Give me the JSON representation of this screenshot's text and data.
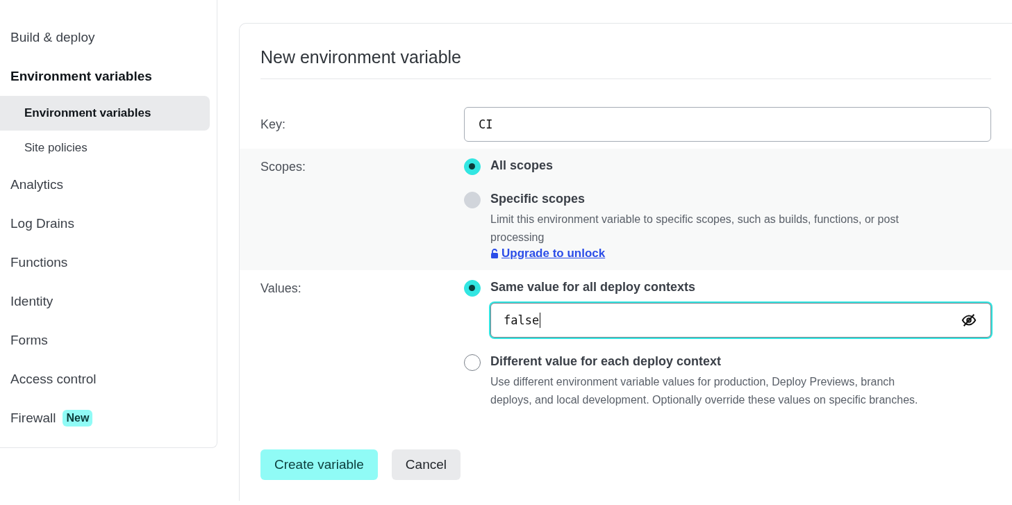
{
  "sidebar": {
    "items": [
      {
        "label": "Build & deploy",
        "selected": false
      },
      {
        "label": "Environment variables",
        "selected": false,
        "children": [
          {
            "label": "Environment variables",
            "selected": true
          },
          {
            "label": "Site policies",
            "selected": false
          }
        ]
      },
      {
        "label": "Analytics",
        "selected": false
      },
      {
        "label": "Log Drains",
        "selected": false
      },
      {
        "label": "Functions",
        "selected": false
      },
      {
        "label": "Identity",
        "selected": false
      },
      {
        "label": "Forms",
        "selected": false
      },
      {
        "label": "Access control",
        "selected": false
      },
      {
        "label": "Firewall",
        "selected": false,
        "badge": "New"
      }
    ]
  },
  "form": {
    "title": "New environment variable",
    "key": {
      "label": "Key:",
      "value": "CI"
    },
    "scopes": {
      "label": "Scopes:",
      "options": [
        {
          "label": "All scopes",
          "selected": true,
          "disabled": false
        },
        {
          "label": "Specific scopes",
          "selected": false,
          "disabled": true,
          "description": "Limit this environment variable to specific scopes, such as builds, functions, or post processing",
          "link": "Upgrade to unlock"
        }
      ]
    },
    "values": {
      "label": "Values:",
      "options": [
        {
          "label": "Same value for all deploy contexts",
          "selected": true,
          "disabled": false,
          "input": {
            "value": "false",
            "focused": true
          }
        },
        {
          "label": "Different value for each deploy context",
          "selected": false,
          "disabled": false,
          "description": "Use different environment variable values for production, Deploy Previews, branch deploys, and local development. Optionally override these values on specific branches."
        }
      ]
    },
    "buttons": [
      {
        "label": "Create variable",
        "kind": "primary"
      },
      {
        "label": "Cancel",
        "kind": "secondary"
      }
    ]
  }
}
